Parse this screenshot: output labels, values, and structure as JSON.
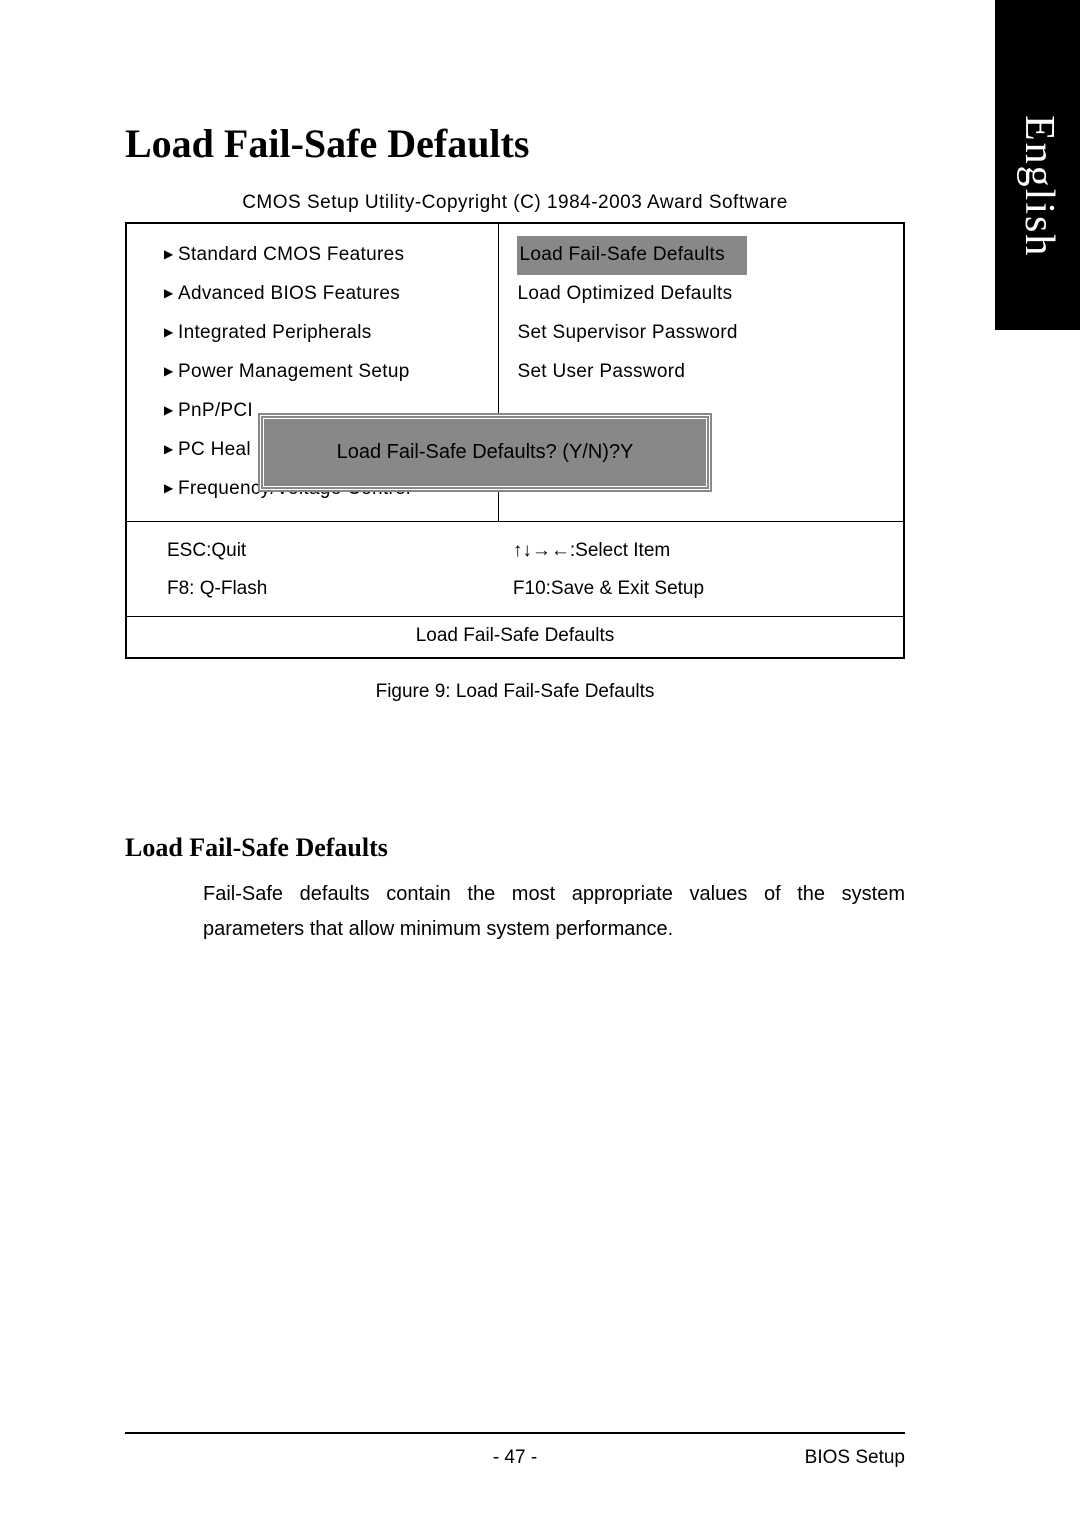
{
  "sideTab": "English",
  "pageTitle": "Load Fail-Safe Defaults",
  "cmosHeader": "CMOS Setup Utility-Copyright (C) 1984-2003 Award Software",
  "menu": {
    "left": [
      "Standard CMOS Features",
      "Advanced BIOS Features",
      "Integrated Peripherals",
      "Power Management Setup",
      "PnP/PCI",
      "PC Heal",
      "Frequency/Voltage Control"
    ],
    "right": [
      "Load Fail-Safe Defaults",
      "Load Optimized Defaults",
      "Set Supervisor Password",
      "Set User Password"
    ]
  },
  "dialogText": "Load Fail-Safe Defaults? (Y/N)?Y",
  "hints": {
    "escQuit": "ESC:Quit",
    "selectItem": "↑↓→←:Select Item",
    "qflash": "F8: Q-Flash",
    "saveExit": "F10:Save & Exit Setup"
  },
  "statusBar": "Load Fail-Safe Defaults",
  "figureCaption": "Figure 9: Load Fail-Safe Defaults",
  "sectionTitle": "Load Fail-Safe Defaults",
  "bodyText": "Fail-Safe defaults contain the most appropriate values of the system parameters that allow minimum system performance.",
  "footer": {
    "pageNum": "- 47 -",
    "section": "BIOS Setup"
  }
}
